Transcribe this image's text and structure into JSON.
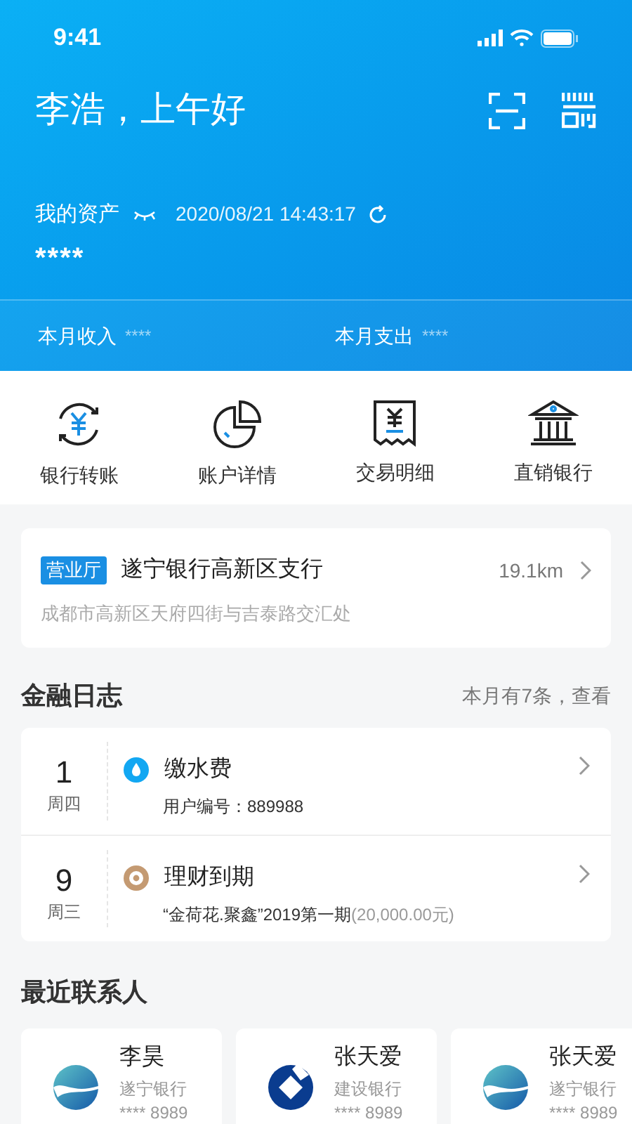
{
  "status_bar": {
    "time": "9:41"
  },
  "header": {
    "greeting": "李浩，上午好",
    "assets_label": "我的资产",
    "timestamp": "2020/08/21 14:43:17",
    "assets_value": "****",
    "summary": [
      {
        "label": "本月收入",
        "value": "****"
      },
      {
        "label": "本月支出",
        "value": "****"
      }
    ]
  },
  "quick_actions": [
    {
      "kind": "transfer",
      "label": "银行转账"
    },
    {
      "kind": "chart",
      "label": "账户详情"
    },
    {
      "kind": "receipt",
      "label": "交易明细"
    },
    {
      "kind": "bank",
      "label": "直销银行"
    }
  ],
  "branch": {
    "tag": "营业厅",
    "name": "遂宁银行高新区支行",
    "distance": "19.1km",
    "address": "成都市高新区天府四街与吉泰路交汇处"
  },
  "journal": {
    "title": "金融日志",
    "summary": "本月有7条，查看",
    "entries": [
      {
        "day": "1",
        "weekday": "周四",
        "kind": "water",
        "title": "缴水费",
        "detail": "用户编号：889988"
      },
      {
        "day": "9",
        "weekday": "周三",
        "kind": "finance",
        "title": "理财到期",
        "detail": "“金荷花.聚鑫”2019第一期",
        "amount": "(20,000.00元)"
      }
    ]
  },
  "contacts": {
    "title": "最近联系人",
    "items": [
      {
        "kind": "suining",
        "name": "李昊",
        "bank": "遂宁银行",
        "account": "**** 8989"
      },
      {
        "kind": "ccb",
        "name": "张天爱",
        "bank": "建设银行",
        "account": "**** 8989"
      },
      {
        "kind": "suining",
        "name": "张天爱",
        "bank": "遂宁银行",
        "account": "**** 8989"
      }
    ]
  }
}
